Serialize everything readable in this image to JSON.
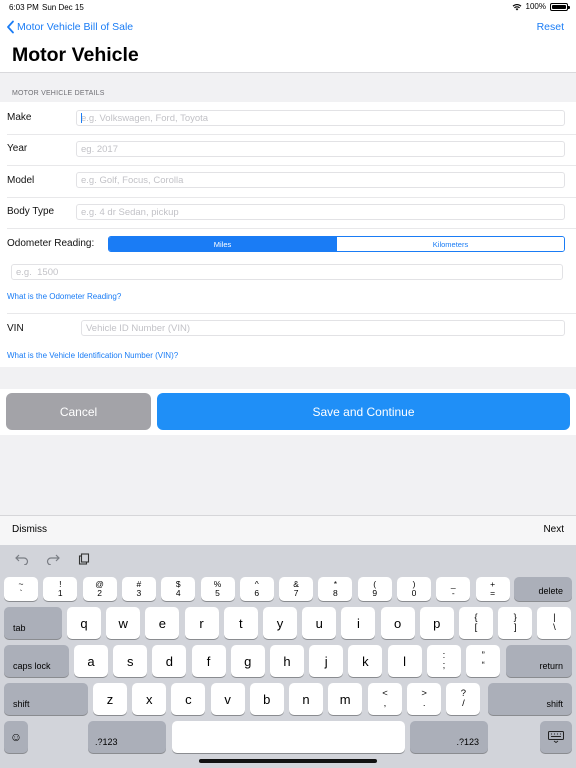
{
  "status": {
    "time": "6:03 PM",
    "date": "Sun Dec 15",
    "battery": "100%"
  },
  "nav": {
    "back_label": "Motor Vehicle Bill of Sale",
    "reset_label": "Reset",
    "title": "Motor Vehicle"
  },
  "section": {
    "header": "MOTOR VEHICLE DETAILS"
  },
  "fields": {
    "make": {
      "label": "Make",
      "placeholder": "e.g. Volkswagen, Ford, Toyota",
      "value": ""
    },
    "year": {
      "label": "Year",
      "placeholder": "eg. 2017",
      "value": ""
    },
    "model": {
      "label": "Model",
      "placeholder": "e.g. Golf, Focus, Corolla",
      "value": ""
    },
    "body_type": {
      "label": "Body Type",
      "placeholder": "e.g. 4 dr Sedan, pickup",
      "value": ""
    },
    "odometer": {
      "label": "Odometer Reading:",
      "placeholder": "e.g.  1500",
      "value": ""
    },
    "vin": {
      "label": "VIN",
      "placeholder": "Vehicle ID Number (VIN)",
      "value": ""
    }
  },
  "odometer_units": {
    "selected": "Miles",
    "options": [
      "Miles",
      "Kilometers"
    ]
  },
  "links": {
    "odometer_help": "What is the Odometer Reading?",
    "vin_help": "What is the Vehicle Identification Number (VIN)?"
  },
  "buttons": {
    "cancel": "Cancel",
    "save": "Save and Continue"
  },
  "accessory": {
    "dismiss": "Dismiss",
    "next": "Next"
  },
  "keyboard": {
    "number_row": [
      [
        "~",
        "`"
      ],
      [
        "!",
        "1"
      ],
      [
        "@",
        "2"
      ],
      [
        "#",
        "3"
      ],
      [
        "$",
        "4"
      ],
      [
        "%",
        "5"
      ],
      [
        "^",
        "6"
      ],
      [
        "&",
        "7"
      ],
      [
        "*",
        "8"
      ],
      [
        "(",
        "9"
      ],
      [
        ")",
        "0"
      ],
      [
        "_",
        "-"
      ],
      [
        "+",
        "="
      ]
    ],
    "row_q": [
      "q",
      "w",
      "e",
      "r",
      "t",
      "y",
      "u",
      "i",
      "o",
      "p"
    ],
    "row_q_extra": [
      [
        "{",
        "["
      ],
      [
        "}",
        "]"
      ],
      [
        "|",
        "\\"
      ]
    ],
    "row_a": [
      "a",
      "s",
      "d",
      "f",
      "g",
      "h",
      "j",
      "k",
      "l"
    ],
    "row_a_extra": [
      [
        ":",
        ";"
      ],
      [
        "”",
        "“"
      ]
    ],
    "row_z": [
      "z",
      "x",
      "c",
      "v",
      "b",
      "n",
      "m"
    ],
    "row_z_extra": [
      [
        "<",
        ","
      ],
      [
        ">",
        "."
      ],
      [
        "?",
        "/"
      ]
    ],
    "labels": {
      "delete": "delete",
      "tab": "tab",
      "caps_lock": "caps lock",
      "return": "return",
      "shift": "shift",
      "numbers": ".?123",
      "emoji": "☺"
    }
  }
}
